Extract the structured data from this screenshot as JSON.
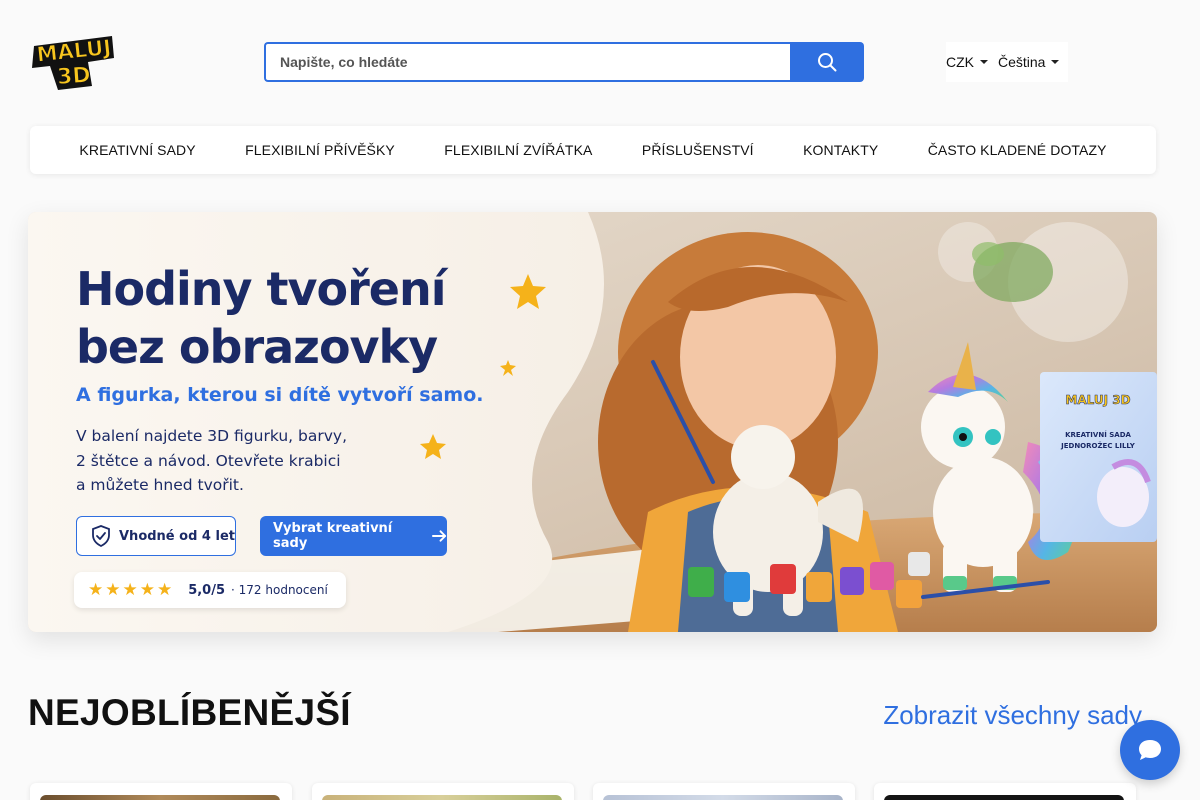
{
  "header": {
    "logo_text_top": "MALUJ",
    "logo_text_bottom": "3D",
    "search": {
      "placeholder": "Napište, co hledáte",
      "value": ""
    },
    "currency": "CZK",
    "language": "Čeština"
  },
  "nav": {
    "items": [
      {
        "label": "KREATIVNÍ SADY"
      },
      {
        "label": "FLEXIBILNÍ PŘÍVĚŠKY"
      },
      {
        "label": "FLEXIBILNÍ ZVÍŘÁTKA"
      },
      {
        "label": "PŘÍSLUŠENSTVÍ"
      },
      {
        "label": "KONTAKTY"
      },
      {
        "label": "ČASTO KLADENÉ DOTAZY"
      }
    ]
  },
  "hero": {
    "title_line1": "Hodiny tvoření",
    "title_line2": "bez obrazovky",
    "subtitle": "A figurka, kterou si dítě vytvoří samo.",
    "body_line1": "V balení najdete 3D figurku, barvy,",
    "body_line2": "2 štětce a návod. Otevřete krabici",
    "body_line3": "a můžete hned tvořit.",
    "age_badge": "Vhodné od 4 let",
    "cta": "Vybrat kreativní sady",
    "rating_stars": "★★★★★",
    "rating_value": "5,0/5",
    "rating_count": "· 172 hodnocení",
    "box_brand": "MALUJ 3D",
    "box_label_line1": "KREATIVNÍ SADA",
    "box_label_line2": "JEDNOROŽEC LILLY"
  },
  "section": {
    "title": "NEJOBLÍBENĚJŠÍ",
    "link": "Zobrazit všechny sady",
    "link_arrow": "→"
  },
  "colors": {
    "accent": "#2f6fe0",
    "navy": "#1b2a66",
    "star": "#f5b21a",
    "logo_yellow": "#f7c51e"
  },
  "icons": {
    "search": "search-icon",
    "shield": "shield-check-icon",
    "arrow": "arrow-right-icon",
    "chat": "chat-bubble-icon"
  }
}
